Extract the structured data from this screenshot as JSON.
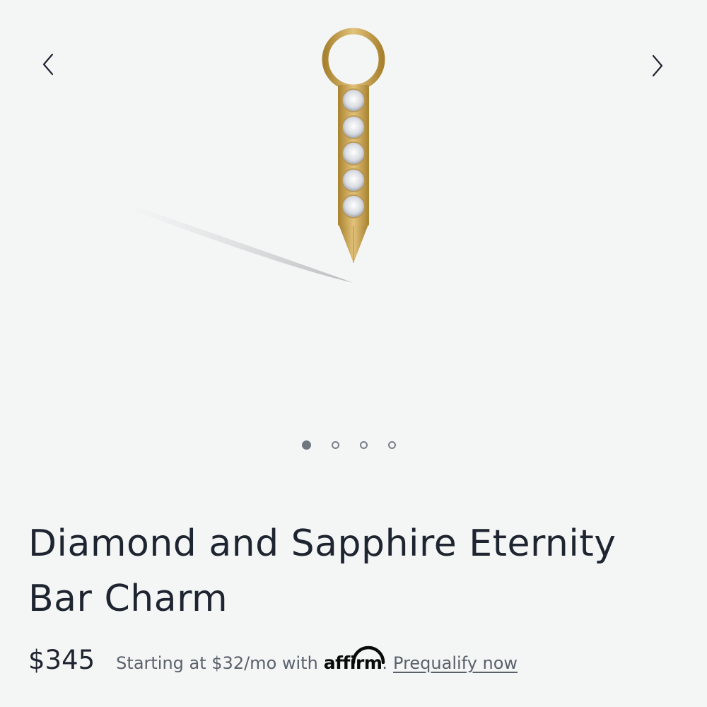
{
  "carousel": {
    "prev_icon": "chevron-left-icon",
    "next_icon": "chevron-right-icon",
    "image_alt": "Diamond and Sapphire Eternity Bar Charm",
    "total_slides": 4,
    "active_slide": 1
  },
  "product": {
    "title_line1": "Diamond and Sapphire Eternity",
    "title_line2": "Bar Charm",
    "price": "$345"
  },
  "financing": {
    "text": "Starting at $32/mo with",
    "brand": "affirm",
    "separator": ".",
    "link": "Prequalify now"
  },
  "colors": {
    "background": "#f4f6f6",
    "text": "#1f2530",
    "muted": "#5a616b",
    "gold": "#c9a34e"
  }
}
